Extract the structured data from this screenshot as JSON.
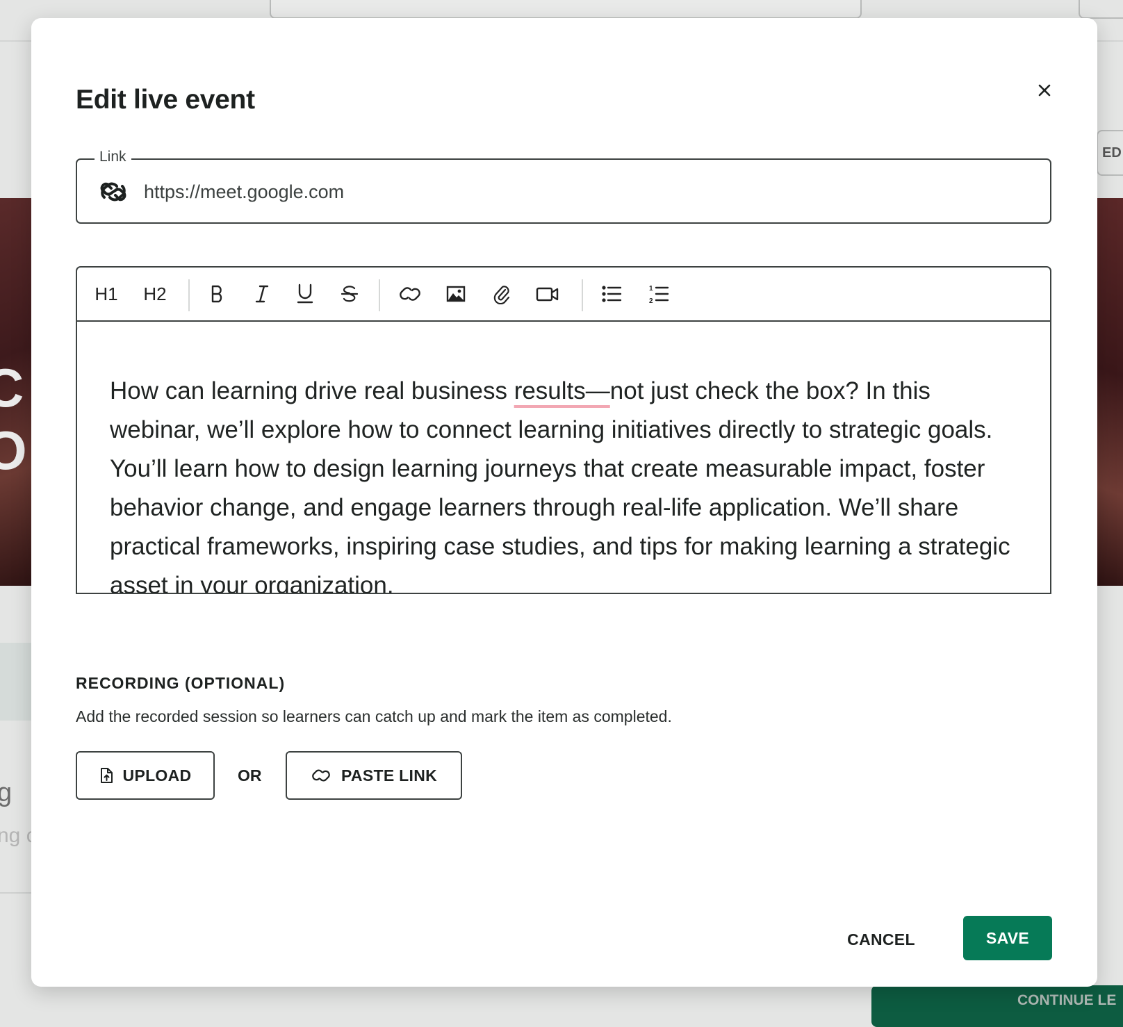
{
  "modal": {
    "title": "Edit live event"
  },
  "link_field": {
    "label": "Link",
    "value": "https://meet.google.com"
  },
  "toolbar": {
    "h1_label": "H1",
    "h2_label": "H2",
    "icons": [
      "bold-icon",
      "italic-icon",
      "underline-icon",
      "strikethrough-icon",
      "link-icon",
      "image-icon",
      "attachment-icon",
      "video-icon",
      "bullet-list-icon",
      "numbered-list-icon"
    ]
  },
  "editor": {
    "text_before": "How can learning drive real business ",
    "text_misspelled": "results—",
    "text_after": "not just check the box? In this webinar, we’ll explore how to connect learning initiatives directly to strategic goals. You’ll learn how to design learning journeys that create measurable impact, foster behavior change, and engage learners through real-life application. We’ll share practical frameworks, inspiring case studies, and tips for making learning a strategic asset in your organization."
  },
  "recording": {
    "title": "RECORDING (OPTIONAL)",
    "description": "Add the recorded session so learners can catch up and mark the item as completed.",
    "upload_label": "UPLOAD",
    "or_label": "OR",
    "paste_link_label": "PASTE LINK"
  },
  "footer": {
    "cancel_label": "CANCEL",
    "save_label": "SAVE"
  },
  "background": {
    "big_text_1": "C",
    "big_text_2": "O",
    "edit_button_partial": "ED",
    "letter_partial": "g",
    "text_partial": "ng c",
    "continue_partial": "CONTINUE LE"
  },
  "colors": {
    "primary": "#067a57",
    "border": "#3d4241",
    "spellcheck": "#f2a7b3"
  }
}
